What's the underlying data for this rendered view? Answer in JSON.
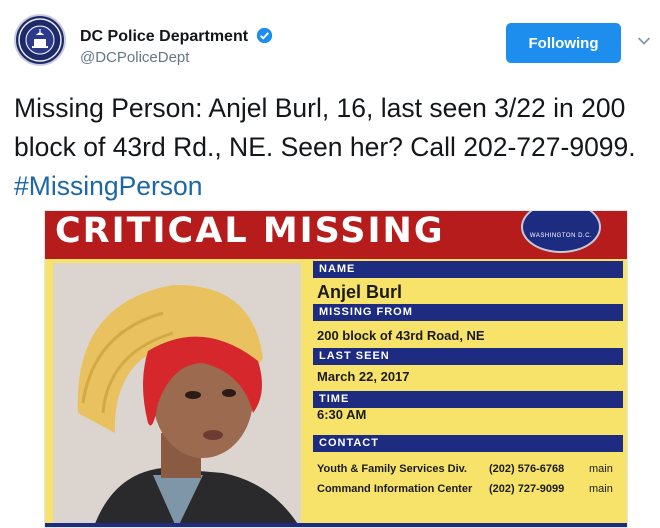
{
  "tweet": {
    "author_name": "DC Police Department",
    "author_handle": "@DCPoliceDept",
    "follow_label": "Following",
    "text_main": "Missing Person: Anjel Burl, 16, last seen 3/22 in 200 block of 43rd Rd., NE.  Seen her?  Call 202-727-9099. ",
    "hashtag": "#MissingPerson",
    "accent_color": "#1d8dee"
  },
  "poster": {
    "title": "CRITICAL MISSING",
    "seal_text": "WASHINGTON D.C.",
    "fields": {
      "name_label": "NAME",
      "name_value": "Anjel  Burl",
      "missing_from_label": "MISSING FROM",
      "missing_from_value": "200 block of 43rd Road, NE",
      "last_seen_label": "LAST SEEN",
      "last_seen_value": "March 22, 2017",
      "time_label": "TIME",
      "time_value": "6:30 AM",
      "contact_label": "CONTACT"
    },
    "contacts": [
      {
        "org": "Youth & Family Services Div.",
        "phone": "(202) 576-6768",
        "type": "main"
      },
      {
        "org": "Command Information Center",
        "phone": "(202) 727-9099",
        "type": "main"
      }
    ],
    "colors": {
      "banner": "#b71c1c",
      "panel": "#f7e36a",
      "bars": "#1d2c80"
    }
  }
}
